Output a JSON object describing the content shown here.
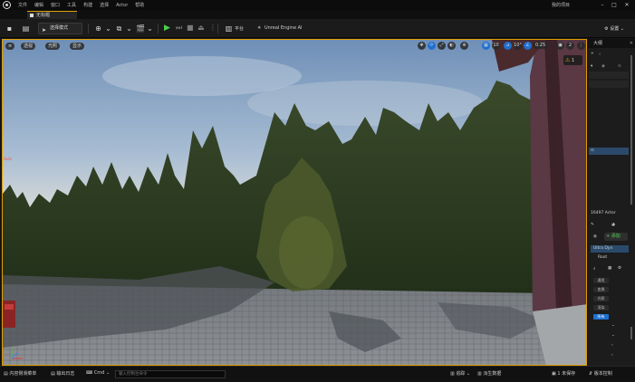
{
  "menubar": {
    "items": [
      "文件",
      "编辑",
      "窗口",
      "工具",
      "构建",
      "选择",
      "Actor",
      "帮助"
    ],
    "project_name": "我的项目",
    "window_buttons": [
      "–",
      "□",
      "✕"
    ]
  },
  "tabs": {
    "level_tab": "无标题"
  },
  "toolbar": {
    "mode_label": "选择模式",
    "platforms_label": "平台",
    "perf_label": "Unreal Engine AI",
    "settings_label": "设置"
  },
  "viewport": {
    "left_buttons": [
      "≡",
      "透视",
      "光照",
      "显示"
    ],
    "right_icons": [
      "✥",
      "⟳",
      "⤢",
      "◐",
      "⊕",
      "▦",
      "10",
      "⊿",
      "10°",
      "∠",
      "0.25",
      "▣",
      "2",
      "⋮"
    ],
    "snap_value": "0.25",
    "warning_count": "1",
    "overlay_text": "Huts"
  },
  "outliner": {
    "header": "大纲",
    "actor_count": "16497 Actor",
    "selected_row": "⊙",
    "details_rows": [
      "Ultra Dyn",
      "Root"
    ],
    "add_button": "添加",
    "buttons": [
      "通用",
      "变换",
      "光照",
      "渲染",
      "所有"
    ]
  },
  "statusbar": {
    "content_drawer": "内容侧滑菜单",
    "output_log": "输出日志",
    "cmd_label": "Cmd",
    "console_placeholder": "输入控制台命令",
    "trace": "追踪",
    "derived_data": "派生数据",
    "unsaved": "1 未保存",
    "source_control": "版本控制"
  }
}
